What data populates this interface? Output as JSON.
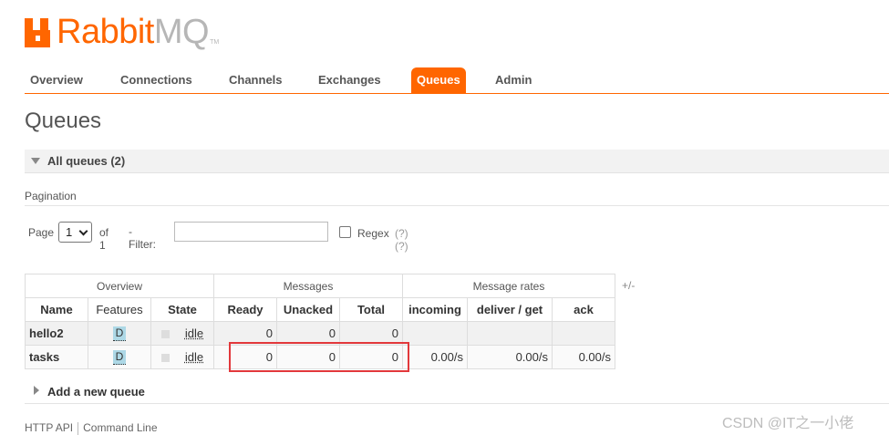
{
  "brand": {
    "name_part1": "Rabbit",
    "name_part2": "MQ",
    "trademark": "TM",
    "accent_color": "#ff6600"
  },
  "nav": {
    "items": [
      {
        "label": "Overview",
        "active": false
      },
      {
        "label": "Connections",
        "active": false
      },
      {
        "label": "Channels",
        "active": false
      },
      {
        "label": "Exchanges",
        "active": false
      },
      {
        "label": "Queues",
        "active": true
      },
      {
        "label": "Admin",
        "active": false
      }
    ]
  },
  "page": {
    "title": "Queues"
  },
  "all_queues": {
    "label": "All queues (2)"
  },
  "pagination": {
    "label": "Pagination",
    "page_word": "Page",
    "page_value": "1",
    "of_text": "of 1",
    "filter_label": "- Filter:",
    "filter_value": "",
    "regex_label": "Regex",
    "regex_help": "(?)(?)"
  },
  "table": {
    "groups": [
      "Overview",
      "Messages",
      "Message rates"
    ],
    "toggle": "+/-",
    "columns": [
      "Name",
      "Features",
      "State",
      "Ready",
      "Unacked",
      "Total",
      "incoming",
      "deliver / get",
      "ack"
    ],
    "rows": [
      {
        "name": "hello2",
        "feature": "D",
        "state": "idle",
        "ready": "0",
        "unacked": "0",
        "total": "0",
        "incoming": "",
        "deliver_get": "",
        "ack": ""
      },
      {
        "name": "tasks",
        "feature": "D",
        "state": "idle",
        "ready": "0",
        "unacked": "0",
        "total": "0",
        "incoming": "0.00/s",
        "deliver_get": "0.00/s",
        "ack": "0.00/s"
      }
    ]
  },
  "add_queue": {
    "label": "Add a new queue"
  },
  "footer": {
    "http_api": "HTTP API",
    "command_line": "Command Line"
  },
  "watermark": "CSDN @IT之一小佬",
  "colors": {
    "highlight": "#e2383b",
    "feature_badge": "#add8e6"
  }
}
